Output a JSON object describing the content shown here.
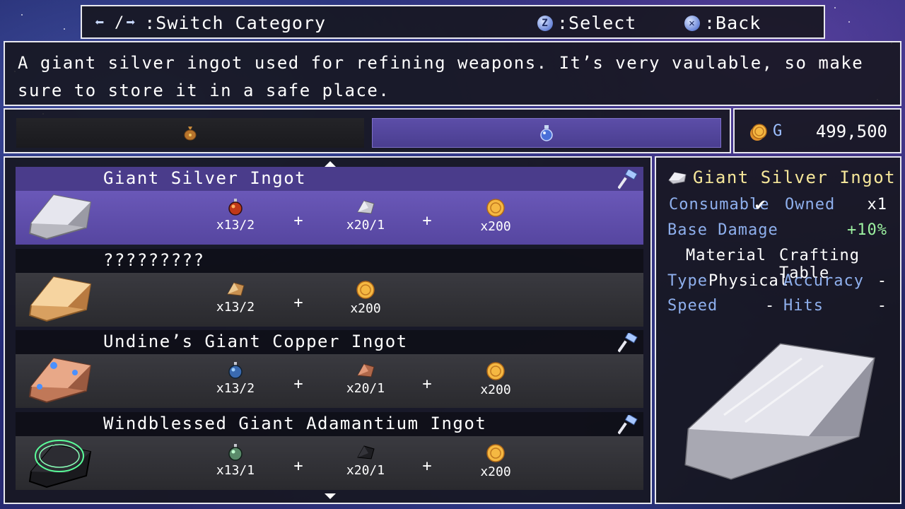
{
  "keybar": {
    "switch_label": ":Switch Category",
    "select_key": "Z",
    "select_label": ":Select",
    "back_key": "✕",
    "back_label": ":Back"
  },
  "description": "A giant silver ingot used for refining weapons. It’s very vaulable, so make sure to store it in a safe place.",
  "gold": {
    "unit": "G",
    "amount": "499,500"
  },
  "tabs": [
    {
      "icon": "bag-icon",
      "selected": false
    },
    {
      "icon": "potion-icon",
      "selected": true
    }
  ],
  "recipes": [
    {
      "name": "Giant Silver Ingot",
      "ingredients": [
        {
          "icon": "red-orb-icon",
          "qty": "x13/2"
        },
        {
          "icon": "silver-ore-icon",
          "qty": "x20/1"
        },
        {
          "icon": "gold-coin-icon",
          "qty": "x200"
        }
      ]
    },
    {
      "name": "?????????",
      "ingredients": [
        {
          "icon": "gold-ore-icon",
          "qty": "x13/2"
        },
        {
          "icon": "gold-coin-icon",
          "qty": "x200"
        }
      ]
    },
    {
      "name": "Undine’s Giant Copper Ingot",
      "ingredients": [
        {
          "icon": "blue-orb-icon",
          "qty": "x13/2"
        },
        {
          "icon": "copper-ore-icon",
          "qty": "x20/1"
        },
        {
          "icon": "gold-coin-icon",
          "qty": "x200"
        }
      ]
    },
    {
      "name": "Windblessed Giant Adamantium Ingot",
      "ingredients": [
        {
          "icon": "green-orb-icon",
          "qty": "x13/1"
        },
        {
          "icon": "dark-ore-icon",
          "qty": "x20/1"
        },
        {
          "icon": "gold-coin-icon",
          "qty": "x200"
        }
      ]
    }
  ],
  "detail": {
    "name": "Giant Silver Ingot",
    "consumable_label": "Consumable",
    "consumable_check": "✔",
    "owned_label": "Owned",
    "owned_value": "x1",
    "base_damage_label": "Base Damage",
    "base_damage_value": "+10%",
    "material_label": "Material",
    "crafting_label": "Crafting Table",
    "type_label": "Type",
    "type_value": "Physical",
    "accuracy_label": "Accuracy",
    "accuracy_value": "-",
    "speed_label": "Speed",
    "speed_value": "-",
    "hits_label": "Hits",
    "hits_value": "-"
  },
  "colors": {
    "selected_row": "#6a58b8",
    "label_blue": "#8fb0ee",
    "title_yellow": "#f6e79a",
    "positive_green": "#9cf0a0"
  }
}
